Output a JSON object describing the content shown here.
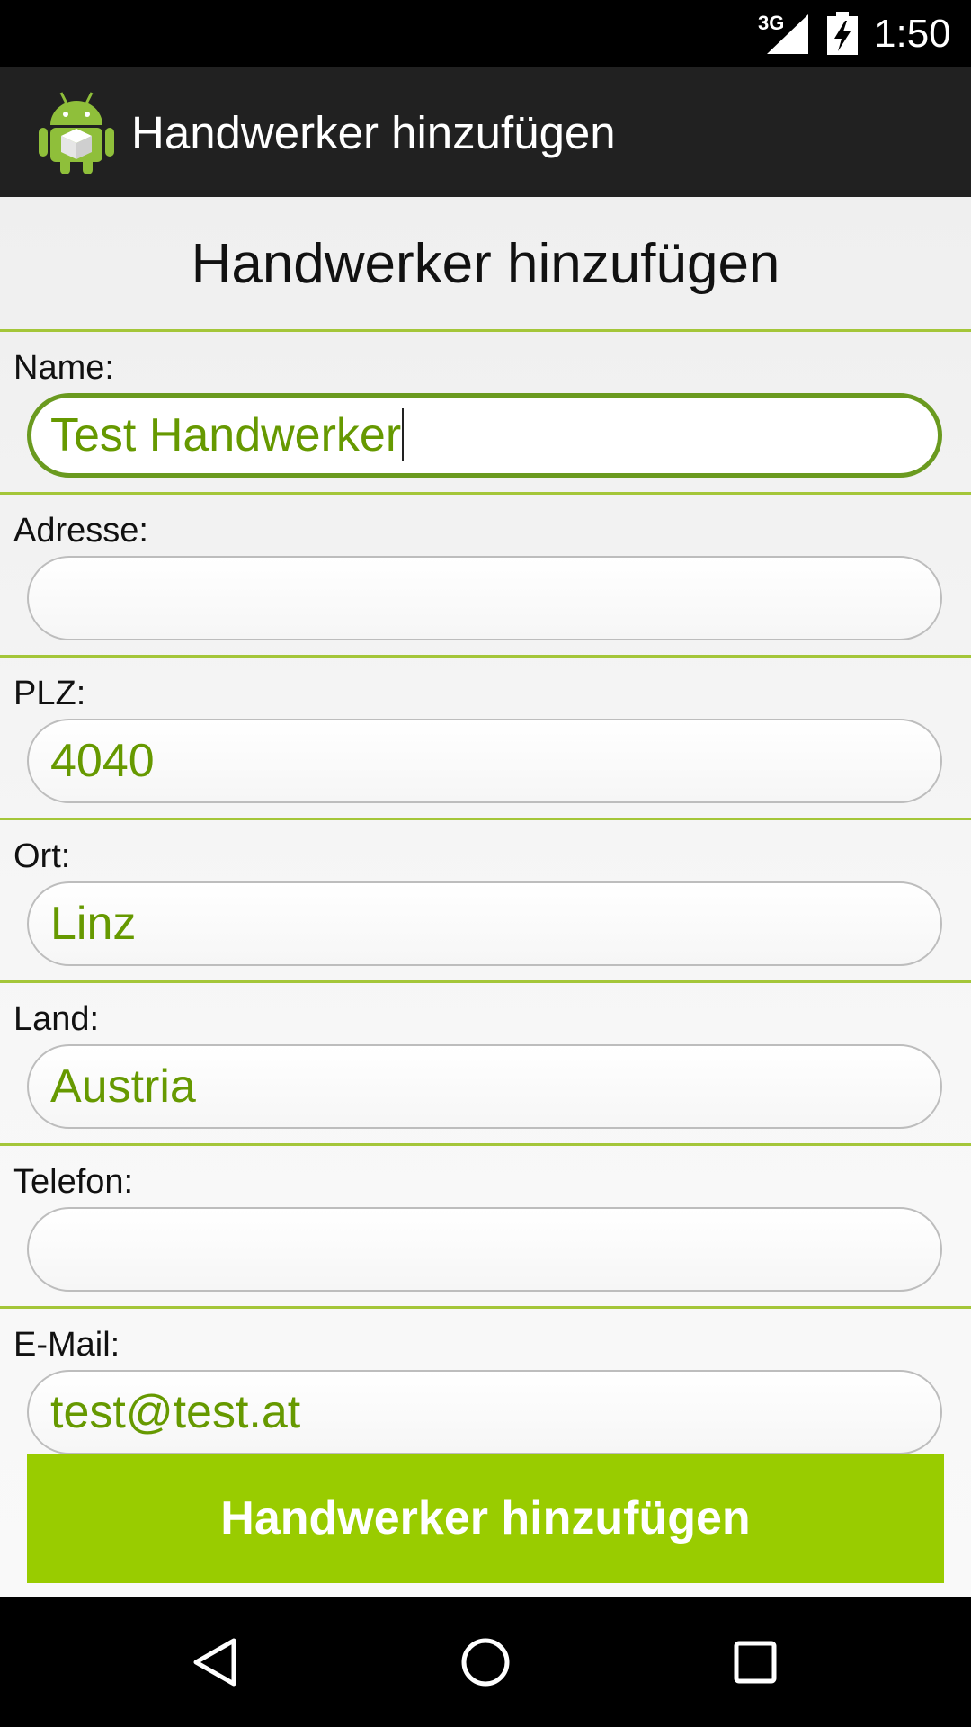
{
  "status_bar": {
    "network": "3G",
    "time": "1:50"
  },
  "action_bar": {
    "title": "Handwerker hinzufügen",
    "icon": "android-robot-icon"
  },
  "form": {
    "heading": "Handwerker hinzufügen",
    "fields": [
      {
        "label": "Name:",
        "value": "Test Handwerker",
        "focused": true
      },
      {
        "label": "Adresse:",
        "value": ""
      },
      {
        "label": "PLZ:",
        "value": "4040"
      },
      {
        "label": "Ort:",
        "value": "Linz"
      },
      {
        "label": "Land:",
        "value": "Austria"
      },
      {
        "label": "Telefon:",
        "value": ""
      },
      {
        "label": "E-Mail:",
        "value": "test@test.at"
      }
    ],
    "submit_label": "Handwerker hinzufügen"
  },
  "nav_bar": {
    "icons": [
      "back-icon",
      "home-icon",
      "recents-icon"
    ]
  },
  "colors": {
    "accent": "#99cc00",
    "divider": "#a4c639",
    "input_text": "#669900",
    "focus_border": "#6a9a1f",
    "action_bar": "#212121"
  }
}
